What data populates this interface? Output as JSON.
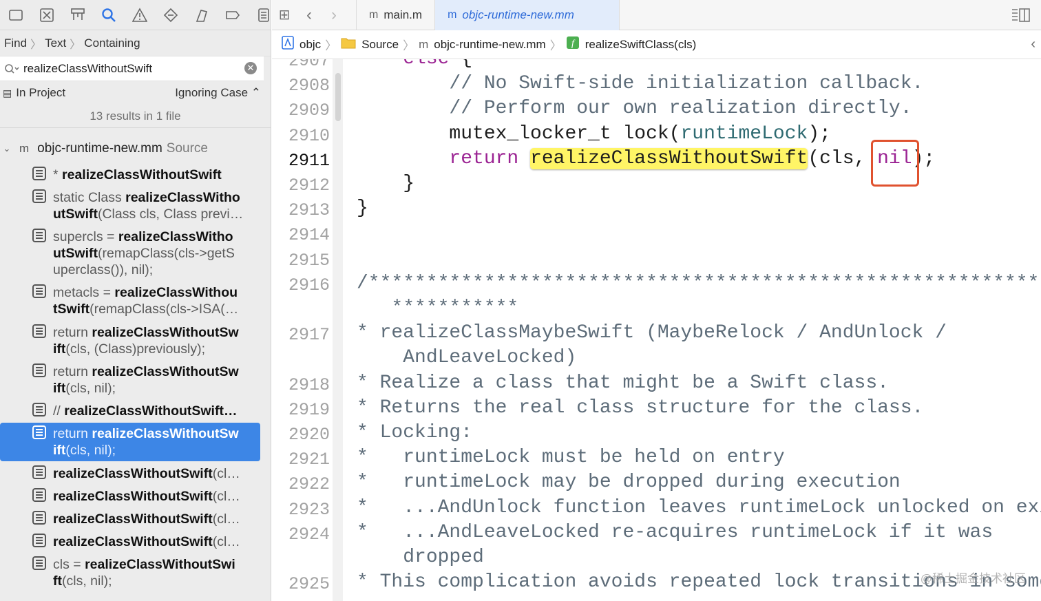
{
  "navigator": {
    "toolbar_icons": [
      "folder-icon",
      "source-control-icon",
      "symbol-icon",
      "find-icon",
      "issue-icon",
      "test-icon",
      "debug-icon",
      "breakpoint-icon",
      "report-icon"
    ],
    "find_bar": {
      "mode": "Find",
      "kind": "Text",
      "match": "Containing"
    },
    "search": {
      "value": "realizeClassWithoutSwift",
      "placeholder": ""
    },
    "scope": {
      "label": "In Project",
      "case": "Ignoring Case ⌃"
    },
    "results_count": "13 results in 1 file",
    "file": {
      "name": "objc-runtime-new.mm",
      "group": "Source"
    },
    "results": [
      {
        "pre": "* ",
        "match": "realizeClassWithoutSwift",
        "post": "",
        "selected": false
      },
      {
        "pre": "static Class ",
        "match": "realizeClassWitho utSwift",
        "post": "(Class cls, Class previ…",
        "selected": false
      },
      {
        "pre": "supercls = ",
        "match": "realizeClassWitho utSwift",
        "post": "(remapClass(cls->getS uperclass()), nil);",
        "selected": false
      },
      {
        "pre": "metacls = ",
        "match": "realizeClassWithou tSwift",
        "post": "(remapClass(cls->ISA(…",
        "selected": false
      },
      {
        "pre": "return ",
        "match": "realizeClassWithoutSw ift",
        "post": "(cls, (Class)previously);",
        "selected": false
      },
      {
        "pre": "return ",
        "match": "realizeClassWithoutSw ift",
        "post": "(cls, nil);",
        "selected": false
      },
      {
        "pre": "//  ",
        "match": "realizeClassWithoutSwift…",
        "post": "",
        "selected": false
      },
      {
        "pre": "return ",
        "match": "realizeClassWithoutSw ift",
        "post": "(cls, nil);",
        "selected": true
      },
      {
        "pre": "",
        "match": "realizeClassWithoutSwift",
        "post": "(cl…",
        "selected": false
      },
      {
        "pre": "",
        "match": "realizeClassWithoutSwift",
        "post": "(cl…",
        "selected": false
      },
      {
        "pre": "",
        "match": "realizeClassWithoutSwift",
        "post": "(cl…",
        "selected": false
      },
      {
        "pre": "",
        "match": "realizeClassWithoutSwift",
        "post": "(cl…",
        "selected": false
      },
      {
        "pre": "cls = ",
        "match": "realizeClassWithoutSwi ft",
        "post": "(cls, nil);",
        "selected": false
      }
    ]
  },
  "tabs": [
    {
      "label": "main.m",
      "active": false
    },
    {
      "label": "objc-runtime-new.mm",
      "active": true
    }
  ],
  "jumpbar": [
    "objc",
    "Source",
    "objc-runtime-new.mm",
    "realizeSwiftClass(cls)"
  ],
  "editor": {
    "lines": [
      {
        "n": "2907",
        "text": "    else {"
      },
      {
        "n": "2908",
        "text": "        // No Swift-side initialization callback."
      },
      {
        "n": "2909",
        "text": "        // Perform our own realization directly."
      },
      {
        "n": "2910",
        "text": "        mutex_locker_t lock(runtimeLock);"
      },
      {
        "n": "2911",
        "text": "        return realizeClassWithoutSwift(cls, nil);"
      },
      {
        "n": "2912",
        "text": "    }"
      },
      {
        "n": "2913",
        "text": "}"
      },
      {
        "n": "2914",
        "text": ""
      },
      {
        "n": "2915",
        "text": ""
      },
      {
        "n": "2916",
        "text": "/**************************************************************"
      },
      {
        "n": "",
        "text": "   ***********"
      },
      {
        "n": "2917",
        "text": "* realizeClassMaybeSwift (MaybeRelock / AndUnlock /"
      },
      {
        "n": "",
        "text": "    AndLeaveLocked)"
      },
      {
        "n": "2918",
        "text": "* Realize a class that might be a Swift class."
      },
      {
        "n": "2919",
        "text": "* Returns the real class structure for the class."
      },
      {
        "n": "2920",
        "text": "* Locking:"
      },
      {
        "n": "2921",
        "text": "*   runtimeLock must be held on entry"
      },
      {
        "n": "2922",
        "text": "*   runtimeLock may be dropped during execution"
      },
      {
        "n": "2923",
        "text": "*   ...AndUnlock function leaves runtimeLock unlocked on exit"
      },
      {
        "n": "2924",
        "text": "*   ...AndLeaveLocked re-acquires runtimeLock if it was"
      },
      {
        "n": "",
        "text": "    dropped"
      },
      {
        "n": "2925",
        "text": "* This complication avoids repeated lock transitions in some"
      }
    ],
    "current_line": "2911"
  },
  "watermark": "@稀土掘金技术社区"
}
